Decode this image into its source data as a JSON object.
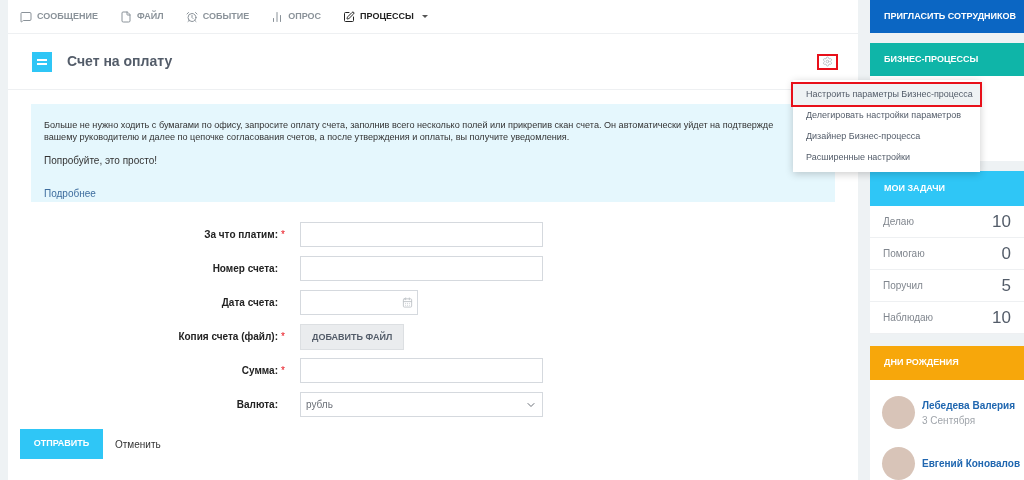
{
  "toolbar": [
    {
      "label": "СООБЩЕНИЕ",
      "kind": "message",
      "selected": false
    },
    {
      "label": "ФАЙЛ",
      "kind": "file",
      "selected": false
    },
    {
      "label": "СОБЫТИЕ",
      "kind": "event",
      "selected": false
    },
    {
      "label": "ОПРОС",
      "kind": "poll",
      "selected": false
    },
    {
      "label": "ПРОЦЕССЫ",
      "kind": "process",
      "selected": true
    }
  ],
  "header": {
    "title": "Счет на оплату",
    "settings_marked": true
  },
  "info": {
    "lines": [
      "Больше не нужно ходить с бумагами по офису, запросите оплату счета, заполнив всего несколько полей или прикрепив скан счета. Он автоматически уйдет на подтвержде",
      "вашему руководителю и далее по цепочке согласования счетов, а после утверждения и оплаты, вы получите уведомления."
    ],
    "tip": "Попробуйте, это просто!",
    "link": "Подробнее"
  },
  "form": [
    {
      "label": "За что платим:",
      "required_mark": "*",
      "kind": "text"
    },
    {
      "label": "Номер счета:",
      "kind": "text"
    },
    {
      "label": "Дата счета:",
      "kind": "date"
    },
    {
      "label": "Копия счета (файл):",
      "required_mark": "*",
      "kind": "file",
      "button": "ДОБАВИТЬ ФАЙЛ"
    },
    {
      "label": "Сумма:",
      "required_mark": "*",
      "kind": "text"
    },
    {
      "label": "Валюта:",
      "kind": "select",
      "value": "рубль"
    }
  ],
  "actions": {
    "submit": "ОТПРАВИТЬ",
    "cancel": "Отменить"
  },
  "menu": [
    {
      "label": "Настроить параметры Бизнес-процесса",
      "selected": true
    },
    {
      "label": "Делегировать настройки параметров",
      "selected": false
    },
    {
      "label": "Дизайнер Бизнес-процесса",
      "selected": false
    },
    {
      "label": "Расширенные настройки",
      "selected": false
    }
  ],
  "sidebar": {
    "invite": "ПРИГЛАСИТЬ СОТРУДНИКОВ",
    "bp_title": "БИЗНЕС-ПРОЦЕССЫ",
    "tasks_title": "МОИ ЗАДАЧИ",
    "tasks": [
      {
        "label": "Делаю",
        "count": "10"
      },
      {
        "label": "Помогаю",
        "count": "0"
      },
      {
        "label": "Поручил",
        "count": "5"
      },
      {
        "label": "Наблюдаю",
        "count": "10"
      }
    ],
    "birthdays_title": "ДНИ РОЖДЕНИЯ",
    "birthdays": [
      {
        "name": "Лебедева Валерия",
        "date": "3 Сентября"
      },
      {
        "name": "Евгений Коновалов"
      }
    ]
  }
}
